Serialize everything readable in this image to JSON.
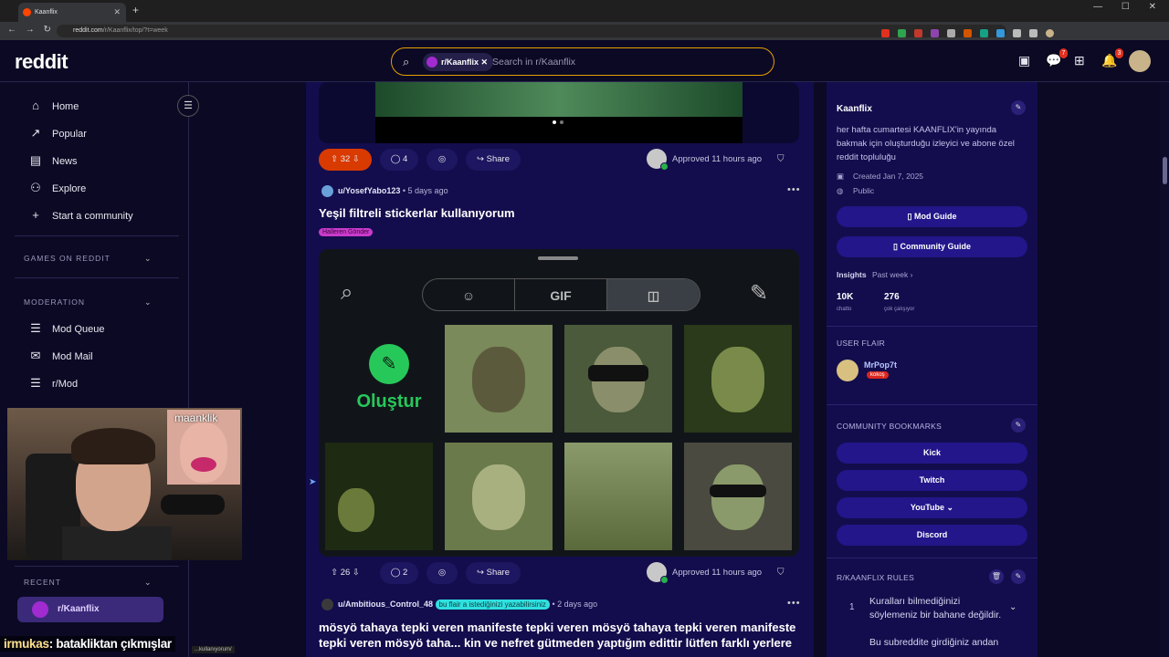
{
  "browser": {
    "tab_title": "Kaanflix",
    "url_host": "reddit.com",
    "url_path": "/r/Kaanflix/top/?t=week",
    "window_controls": [
      "—",
      "☐",
      "✕"
    ]
  },
  "header": {
    "logo": "reddit",
    "search_chip": "r/Kaanflix",
    "search_placeholder": "Search in r/Kaanflix",
    "chat_badge": "7",
    "notif_badge": "3"
  },
  "left_nav": {
    "items": [
      {
        "label": "Home",
        "icon": "home-icon"
      },
      {
        "label": "Popular",
        "icon": "popular-icon"
      },
      {
        "label": "News",
        "icon": "news-icon"
      },
      {
        "label": "Explore",
        "icon": "explore-icon"
      },
      {
        "label": "Start a community",
        "icon": "plus-icon"
      }
    ],
    "games_header": "GAMES ON REDDIT",
    "moderation_header": "MODERATION",
    "mod_items": [
      {
        "label": "Mod Queue",
        "icon": "mod-queue-icon"
      },
      {
        "label": "Mod Mail",
        "icon": "mail-icon"
      },
      {
        "label": "r/Mod",
        "icon": "mod-icon"
      }
    ],
    "recent_header": "RECENT",
    "recent_item": "r/Kaanflix"
  },
  "stream_overlay": {
    "pip_name": "maanklik",
    "chat_user": "irmukas",
    "chat_text": ": batakliktan çıkmışlar",
    "status_url": "...kullanıyorum/"
  },
  "posts": [
    {
      "votes": "32",
      "comments": "4",
      "share": "Share",
      "approved": "Approved 11 hours ago"
    },
    {
      "author": "u/YosefYabo123",
      "time": "• 5 days ago",
      "title": "Yeşil filtreli stickerlar kullanıyorum",
      "flair": "Halleren Gönder",
      "sticker_tabs": [
        "",
        "GIF",
        ""
      ],
      "create_label": "Oluştur",
      "votes": "26",
      "comments": "2",
      "share": "Share",
      "approved": "Approved 11 hours ago"
    },
    {
      "author": "u/Ambitious_Control_48",
      "flair": "bu flair a istediğinizi yazabilirsiniz",
      "time": "• 2 days ago",
      "title": "mösyö tahaya tepki veren manifeste tepki veren mösyö tahaya tepki veren manifeste tepki veren mösyö taha... kin ve nefret gütmeden yaptığım edittir lütfen farklı yerlere"
    }
  ],
  "community": {
    "name": "Kaanflix",
    "description": "her hafta cumartesi KAANFLIX'in yayında bakmak için oluşturduğu izleyici ve abone özel reddit topluluğu",
    "created": "Created Jan 7, 2025",
    "visibility": "Public",
    "mod_guide": "Mod Guide",
    "community_guide": "Community Guide",
    "insights_label": "Insights",
    "insights_period": "Past week ›",
    "stat1_value": "10K",
    "stat1_label": "chatto",
    "stat2_value": "276",
    "stat2_label": "çok çalışıyor",
    "user_flair_header": "USER FLAIR",
    "user_flair_name": "MrPop7t",
    "user_flair_tag": "kokoş",
    "bookmarks_header": "COMMUNITY BOOKMARKS",
    "bookmarks": [
      "Kick",
      "Twitch",
      "YouTube ⌄",
      "Discord"
    ],
    "rules_header": "R/KAANFLIX RULES",
    "rules": [
      {
        "num": "1",
        "text": "Kuralları bilmediğinizi söylemeniz bir bahane değildir."
      },
      {
        "num": "",
        "text": "Bu subreddite girdiğiniz andan"
      }
    ]
  },
  "colors": {
    "accent_orange": "#d93a00",
    "bg": "#0b0924",
    "panel": "#130d4d",
    "button": "#22168a",
    "green": "#27c85a"
  }
}
